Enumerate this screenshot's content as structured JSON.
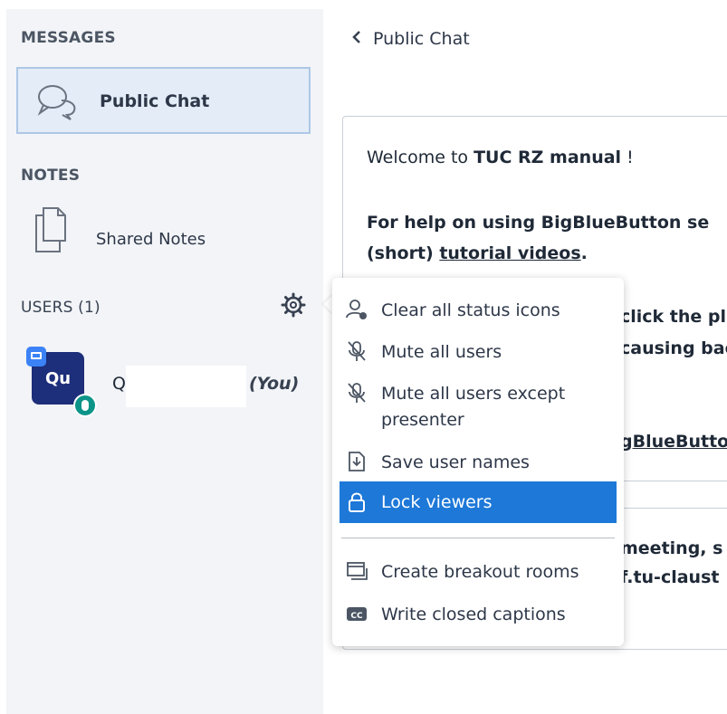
{
  "sidebar": {
    "messages_title": "MESSAGES",
    "public_chat_label": "Public Chat",
    "notes_title": "NOTES",
    "shared_notes_label": "Shared Notes",
    "users_title": "USERS (1)",
    "user": {
      "avatar_initials": "Qu",
      "name": "Q",
      "you_label": "(You)"
    }
  },
  "chat": {
    "header_title": "Public Chat",
    "welcome_prefix": "Welcome to ",
    "welcome_bold": "TUC RZ manual",
    "welcome_suffix": " !",
    "help_line1": "For help on using BigBlueButton se",
    "help_line2_prefix": "(short) ",
    "help_line2_link": "tutorial videos",
    "help_line2_suffix": ".",
    "partial_line3": "click the pl",
    "partial_line4": "causing bac",
    "partial_line5": "gBlueButto",
    "partial_line6": "meeting, s",
    "partial_line7": "f.tu-claust"
  },
  "menu": {
    "items": [
      {
        "label": "Clear all status icons",
        "icon": "user-clear-icon"
      },
      {
        "label": "Mute all users",
        "icon": "mic-muted-icon"
      },
      {
        "label": "Mute all users except presenter",
        "icon": "mic-muted-icon"
      },
      {
        "label": "Save user names",
        "icon": "save-icon"
      },
      {
        "label": "Lock viewers",
        "icon": "lock-icon",
        "active": true
      },
      {
        "label": "Create breakout rooms",
        "icon": "breakout-icon"
      },
      {
        "label": "Write closed captions",
        "icon": "cc-icon"
      }
    ],
    "mute_except_line1": "Mute all users except",
    "mute_except_line2": "presenter"
  },
  "colors": {
    "sidebar_bg": "#f2f4f7",
    "active_item_bg": "#e3ecf7",
    "menu_active_bg": "#1d78d8",
    "avatar_bg": "#1d2e7a",
    "mic_badge": "#0d9488"
  }
}
